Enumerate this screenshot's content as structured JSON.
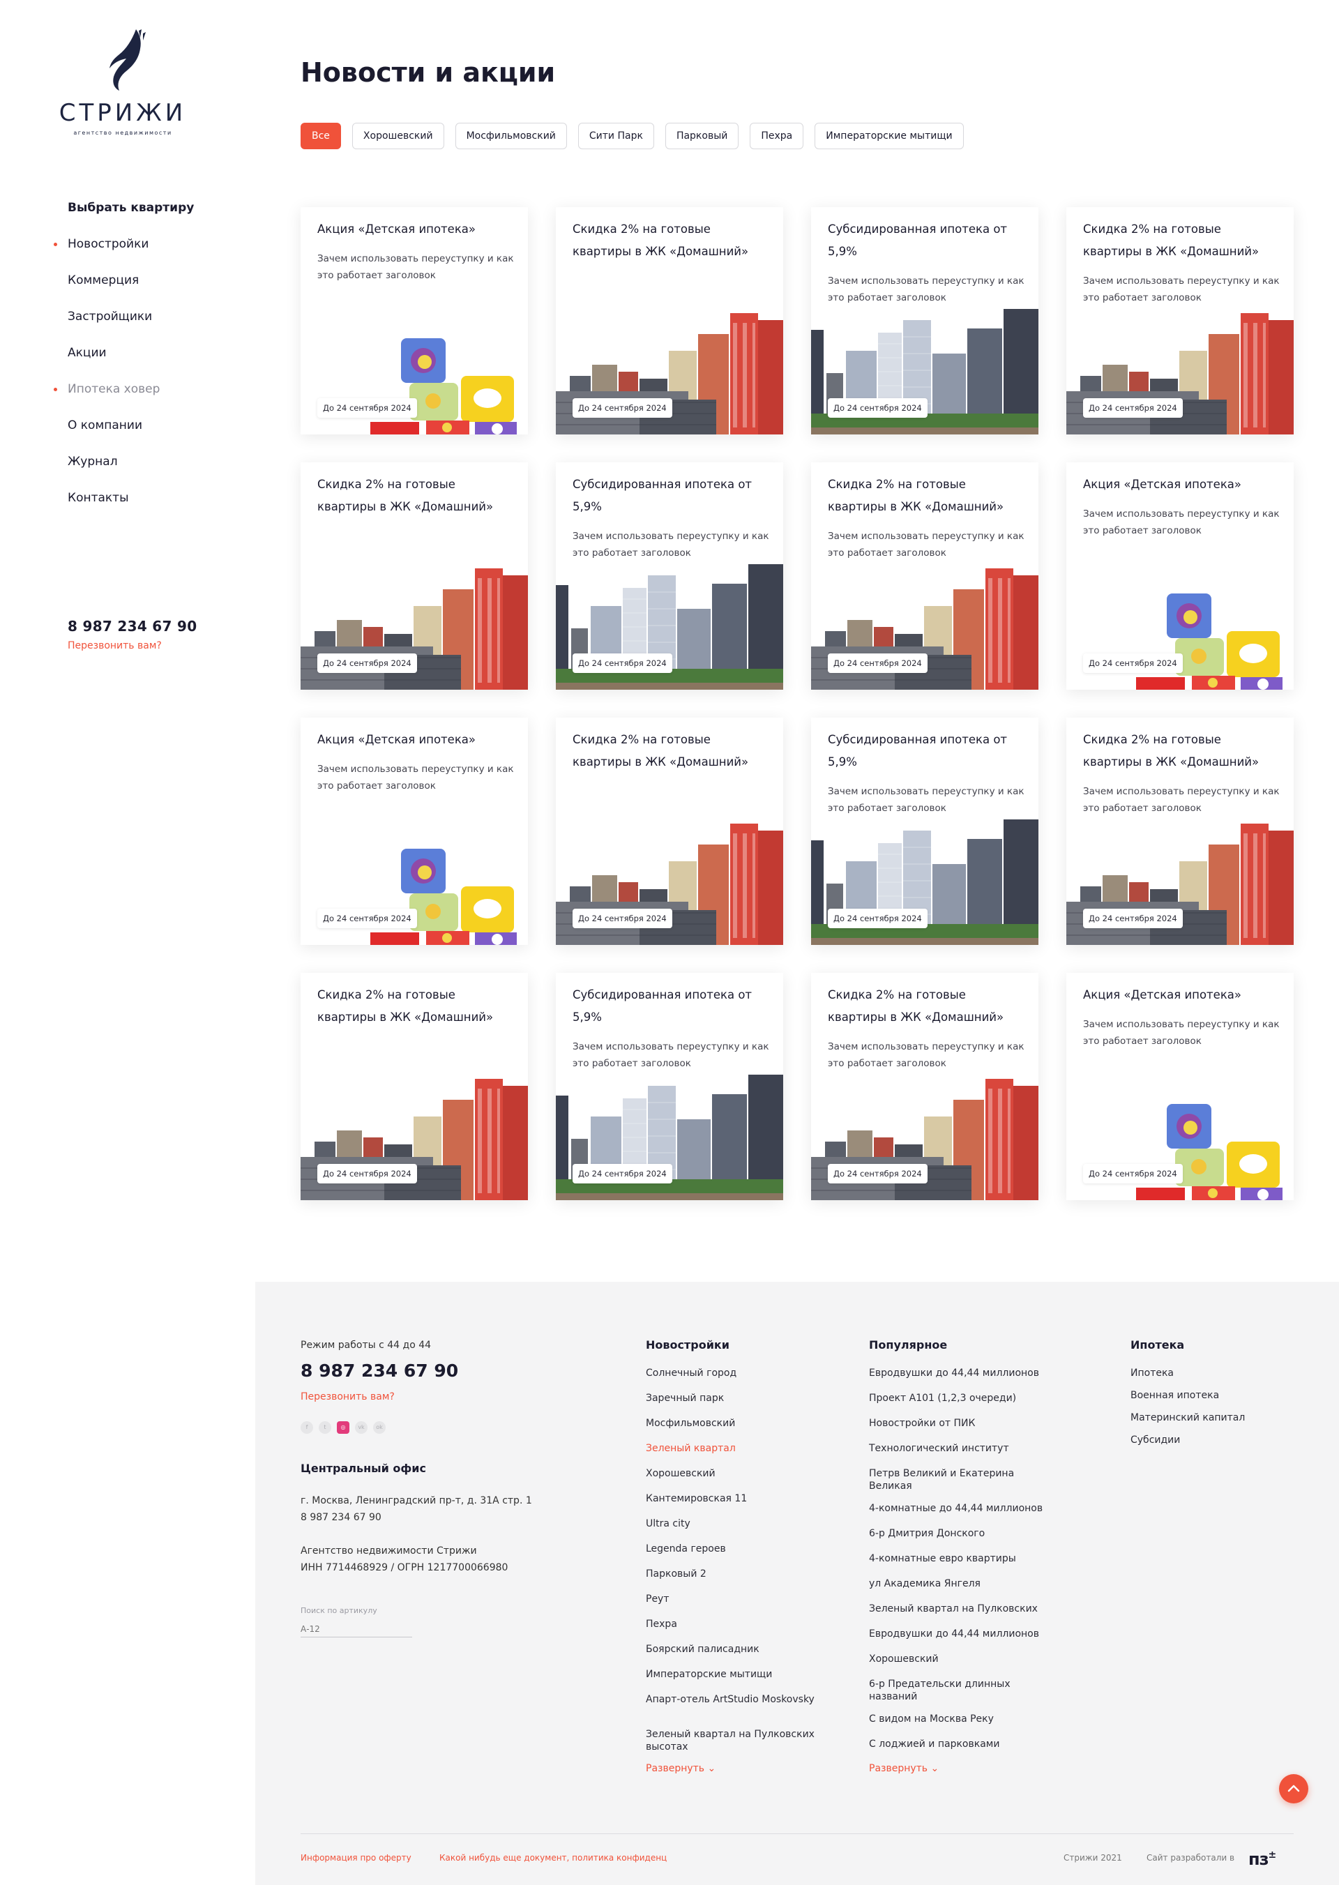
{
  "brand": {
    "name": "СТРИЖИ",
    "tagline": "агентство недвижимости"
  },
  "sidebar": {
    "nav": [
      {
        "label": "Выбрать квартиру",
        "style": "bold"
      },
      {
        "label": "Новостройки",
        "style": "dot"
      },
      {
        "label": "Коммерция",
        "style": ""
      },
      {
        "label": "Застройщики",
        "style": ""
      },
      {
        "label": "Акции",
        "style": ""
      },
      {
        "label": "Ипотека ховер",
        "style": "muted dot"
      },
      {
        "label": "О компании",
        "style": ""
      },
      {
        "label": "Журнал",
        "style": ""
      },
      {
        "label": "Контакты",
        "style": ""
      }
    ],
    "phone": "8 987 234 67 90",
    "callback": "Перезвонить вам?"
  },
  "page": {
    "title": "Новости и акции"
  },
  "filters": [
    {
      "label": "Все",
      "active": true
    },
    {
      "label": "Хорошевский",
      "active": false
    },
    {
      "label": "Мосфильмовский",
      "active": false
    },
    {
      "label": "Сити Парк",
      "active": false
    },
    {
      "label": "Парковый",
      "active": false
    },
    {
      "label": "Пехра",
      "active": false
    },
    {
      "label": "Императорские мытищи",
      "active": false
    }
  ],
  "cards": [
    {
      "title": "Акция «Детская ипотека»",
      "desc": "Зачем использовать переуступку и как это работает заголовок",
      "date": "До 24 сентября 2024",
      "image": "toy-blocks"
    },
    {
      "title": "Скидка 2% на готовые квартиры в ЖК «Домашний»",
      "desc": "",
      "date": "До 24 сентября 2024",
      "image": "red-towers"
    },
    {
      "title": "Субсидированная ипотека от 5,9%",
      "desc": "Зачем использовать переуступку и как это работает заголовок",
      "date": "До 24 сентября 2024",
      "image": "glass-towers"
    },
    {
      "title": "Скидка 2% на готовые квартиры в ЖК «Домашний»",
      "desc": "Зачем использовать переуступку и как это работает заголовок",
      "date": "До 24 сентября 2024",
      "image": "red-towers"
    },
    {
      "title": "Скидка 2% на готовые квартиры в ЖК «Домашний»",
      "desc": "",
      "date": "До 24 сентября 2024",
      "image": "red-towers"
    },
    {
      "title": "Субсидированная ипотека от 5,9%",
      "desc": "Зачем использовать переуступку и как это работает заголовок",
      "date": "До 24 сентября 2024",
      "image": "glass-towers"
    },
    {
      "title": "Скидка 2% на готовые квартиры в ЖК «Домашний»",
      "desc": "Зачем использовать переуступку и как это работает заголовок",
      "date": "До 24 сентября 2024",
      "image": "red-towers"
    },
    {
      "title": "Акция «Детская ипотека»",
      "desc": "Зачем использовать переуступку и как это работает заголовок",
      "date": "До 24 сентября 2024",
      "image": "toy-blocks"
    },
    {
      "title": "Акция «Детская ипотека»",
      "desc": "Зачем использовать переуступку и как это работает заголовок",
      "date": "До 24 сентября 2024",
      "image": "toy-blocks"
    },
    {
      "title": "Скидка 2% на готовые квартиры в ЖК «Домашний»",
      "desc": "",
      "date": "До 24 сентября 2024",
      "image": "red-towers"
    },
    {
      "title": "Субсидированная ипотека от 5,9%",
      "desc": "Зачем использовать переуступку и как это работает заголовок",
      "date": "До 24 сентября 2024",
      "image": "glass-towers"
    },
    {
      "title": "Скидка 2% на готовые квартиры в ЖК «Домашний»",
      "desc": "Зачем использовать переуступку и как это работает заголовок",
      "date": "До 24 сентября 2024",
      "image": "red-towers"
    },
    {
      "title": "Скидка 2% на готовые квартиры в ЖК «Домашний»",
      "desc": "",
      "date": "До 24 сентября 2024",
      "image": "red-towers"
    },
    {
      "title": "Субсидированная ипотека от 5,9%",
      "desc": "Зачем использовать переуступку и как это работает заголовок",
      "date": "До 24 сентября 2024",
      "image": "glass-towers"
    },
    {
      "title": "Скидка 2% на готовые квартиры в ЖК «Домашний»",
      "desc": "Зачем использовать переуступку и как это работает заголовок",
      "date": "До 24 сентября 2024",
      "image": "red-towers"
    },
    {
      "title": "Акция «Детская ипотека»",
      "desc": "Зачем использовать переуступку и как это работает заголовок",
      "date": "До 24 сентября 2024",
      "image": "toy-blocks"
    }
  ],
  "footer": {
    "hours": "Режим работы с 44 до 44",
    "phone": "8 987 234 67 90",
    "callback": "Перезвонить вам?",
    "socials": [
      "facebook-icon",
      "twitter-icon",
      "instagram-icon",
      "vk-icon",
      "odnoklassniki-icon"
    ],
    "office": {
      "title": "Центральный офис",
      "address": "г. Москва, Ленинградский пр-т, д. 31А стр. 1",
      "phone": "8 987 234 67 90",
      "company": "Агентство недвижимости Стрижи",
      "requisites": "ИНН  7714468929 / ОГРН 1217700066980"
    },
    "search": {
      "label": "Поиск по артикулу",
      "placeholder": "А-12"
    },
    "columns": [
      {
        "title": "Новостройки",
        "items": [
          "Солнечный город",
          "Заречный парк",
          "Мосфильмовский",
          "Зеленый квартал",
          "Хорошевский",
          "Кантемировская 11",
          "Ultra city",
          "Legenda героев",
          "Парковый 2",
          "Реут",
          "Пехра",
          "Боярский палисадник",
          "Императорские мытищи",
          "Апарт-отель ArtStudio Moskovsky",
          "Зеленый квартал на Пулковских высотах"
        ],
        "accent_index": 3,
        "expand": "Развернуть"
      },
      {
        "title": "Популярное",
        "items": [
          "Евродвушки до 44,44 миллионов",
          "Проект A101 (1,2,3 очереди)",
          "Новостройки от ПИК",
          "Технологический институт",
          "Петрв Великий и Екатерина Великая",
          "4-комнатные до 44,44 миллионов",
          "6-р Дмитрия Донского",
          "4-комнатные евро квартиры",
          "ул Академика Янгеля",
          "Зеленый квартал на Пулковских",
          "Евродвушки до 44,44 миллионов",
          "Хорошевский",
          "6-р Предательски длинных названий",
          "С видом на Москва Реку",
          "С лоджией и парковками"
        ],
        "expand": "Развернуть"
      },
      {
        "title": "Ипотека",
        "items": [
          "Ипотека",
          "Военная ипотека",
          "Материнский капитал",
          "Субсидии"
        ]
      }
    ],
    "bottom": {
      "offer": "Информация про оферту",
      "policy": "Какой нибудь еще документ, политика конфиденц",
      "copyright": "Стрижи 2021",
      "developed_by": "Сайт разработали в",
      "dev_logo": "пз"
    }
  },
  "colors": {
    "accent": "#f0523a",
    "text": "#1b1b2e",
    "footer_bg": "#f4f4f5"
  }
}
